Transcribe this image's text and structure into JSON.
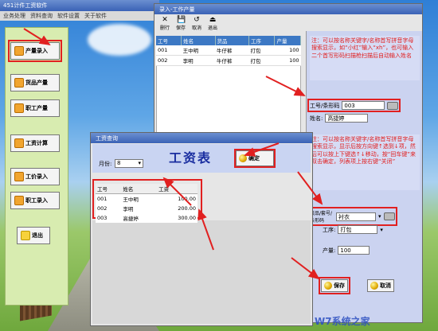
{
  "main_window": {
    "title": "451计件工资软件",
    "menu": [
      "业务处理",
      "资料查询",
      "软件设置",
      "关于软件"
    ]
  },
  "nav": [
    {
      "label": "产量录入"
    },
    {
      "label": "货品产量"
    },
    {
      "label": "职工产量"
    },
    {
      "label": "工资计算"
    },
    {
      "label": "工价录入"
    },
    {
      "label": "职工录入"
    },
    {
      "label": "退出"
    }
  ],
  "entry_window": {
    "title": "录入-工作产量",
    "toolbar": [
      {
        "label": "删行",
        "icon": "delete-row-icon",
        "glyph": "✕"
      },
      {
        "label": "保存",
        "icon": "save-icon",
        "glyph": "💾"
      },
      {
        "label": "取消",
        "icon": "cancel-icon",
        "glyph": "↺"
      },
      {
        "label": "退出",
        "icon": "exit-icon",
        "glyph": "⏏"
      }
    ],
    "columns": [
      "工号",
      "姓名",
      "货品",
      "工序",
      "产量"
    ],
    "rows": [
      [
        "001",
        "王中明",
        "牛仔裤",
        "打包",
        "100"
      ],
      [
        "002",
        "李明",
        "牛仔裤",
        "打包",
        "100"
      ]
    ],
    "note1": "注：可以按名称关键字/名称首写拼音字母搜索显示，如“小红”输入“xh”，也可输入二个首写形码扫描枪扫描后自动输入姓名",
    "employee_label": "工号/条形码",
    "employee_value": "003",
    "name_label": "姓名:",
    "name_value": "高捷婷",
    "note2": "注：可以按名称关键字/名称首写拼音字母搜索显示，显示后按方向键↑选到↓项，然后可以按上下键选↑↓移动，按“回车键”来双击确定，列表项上按右键“关闭”",
    "product_label": "货品/套号/条形码",
    "product_value": "衬衣",
    "process_label": "工序:",
    "process_value": "打包",
    "quantity_label": "产量:",
    "quantity_value": "100",
    "save_label": "保存",
    "cancel_label": "取消"
  },
  "salary_window": {
    "title": "工资查询",
    "heading": "工资表",
    "month_label": "月份:",
    "month_value": "8",
    "confirm_label": "确定",
    "columns": [
      "工号",
      "姓名",
      "工资"
    ],
    "rows": [
      [
        "001",
        "王中明",
        "100.00"
      ],
      [
        "002",
        "李明",
        "200.00"
      ],
      [
        "003",
        "高捷婷",
        "300.00"
      ]
    ]
  },
  "watermark": "W7系统之家"
}
